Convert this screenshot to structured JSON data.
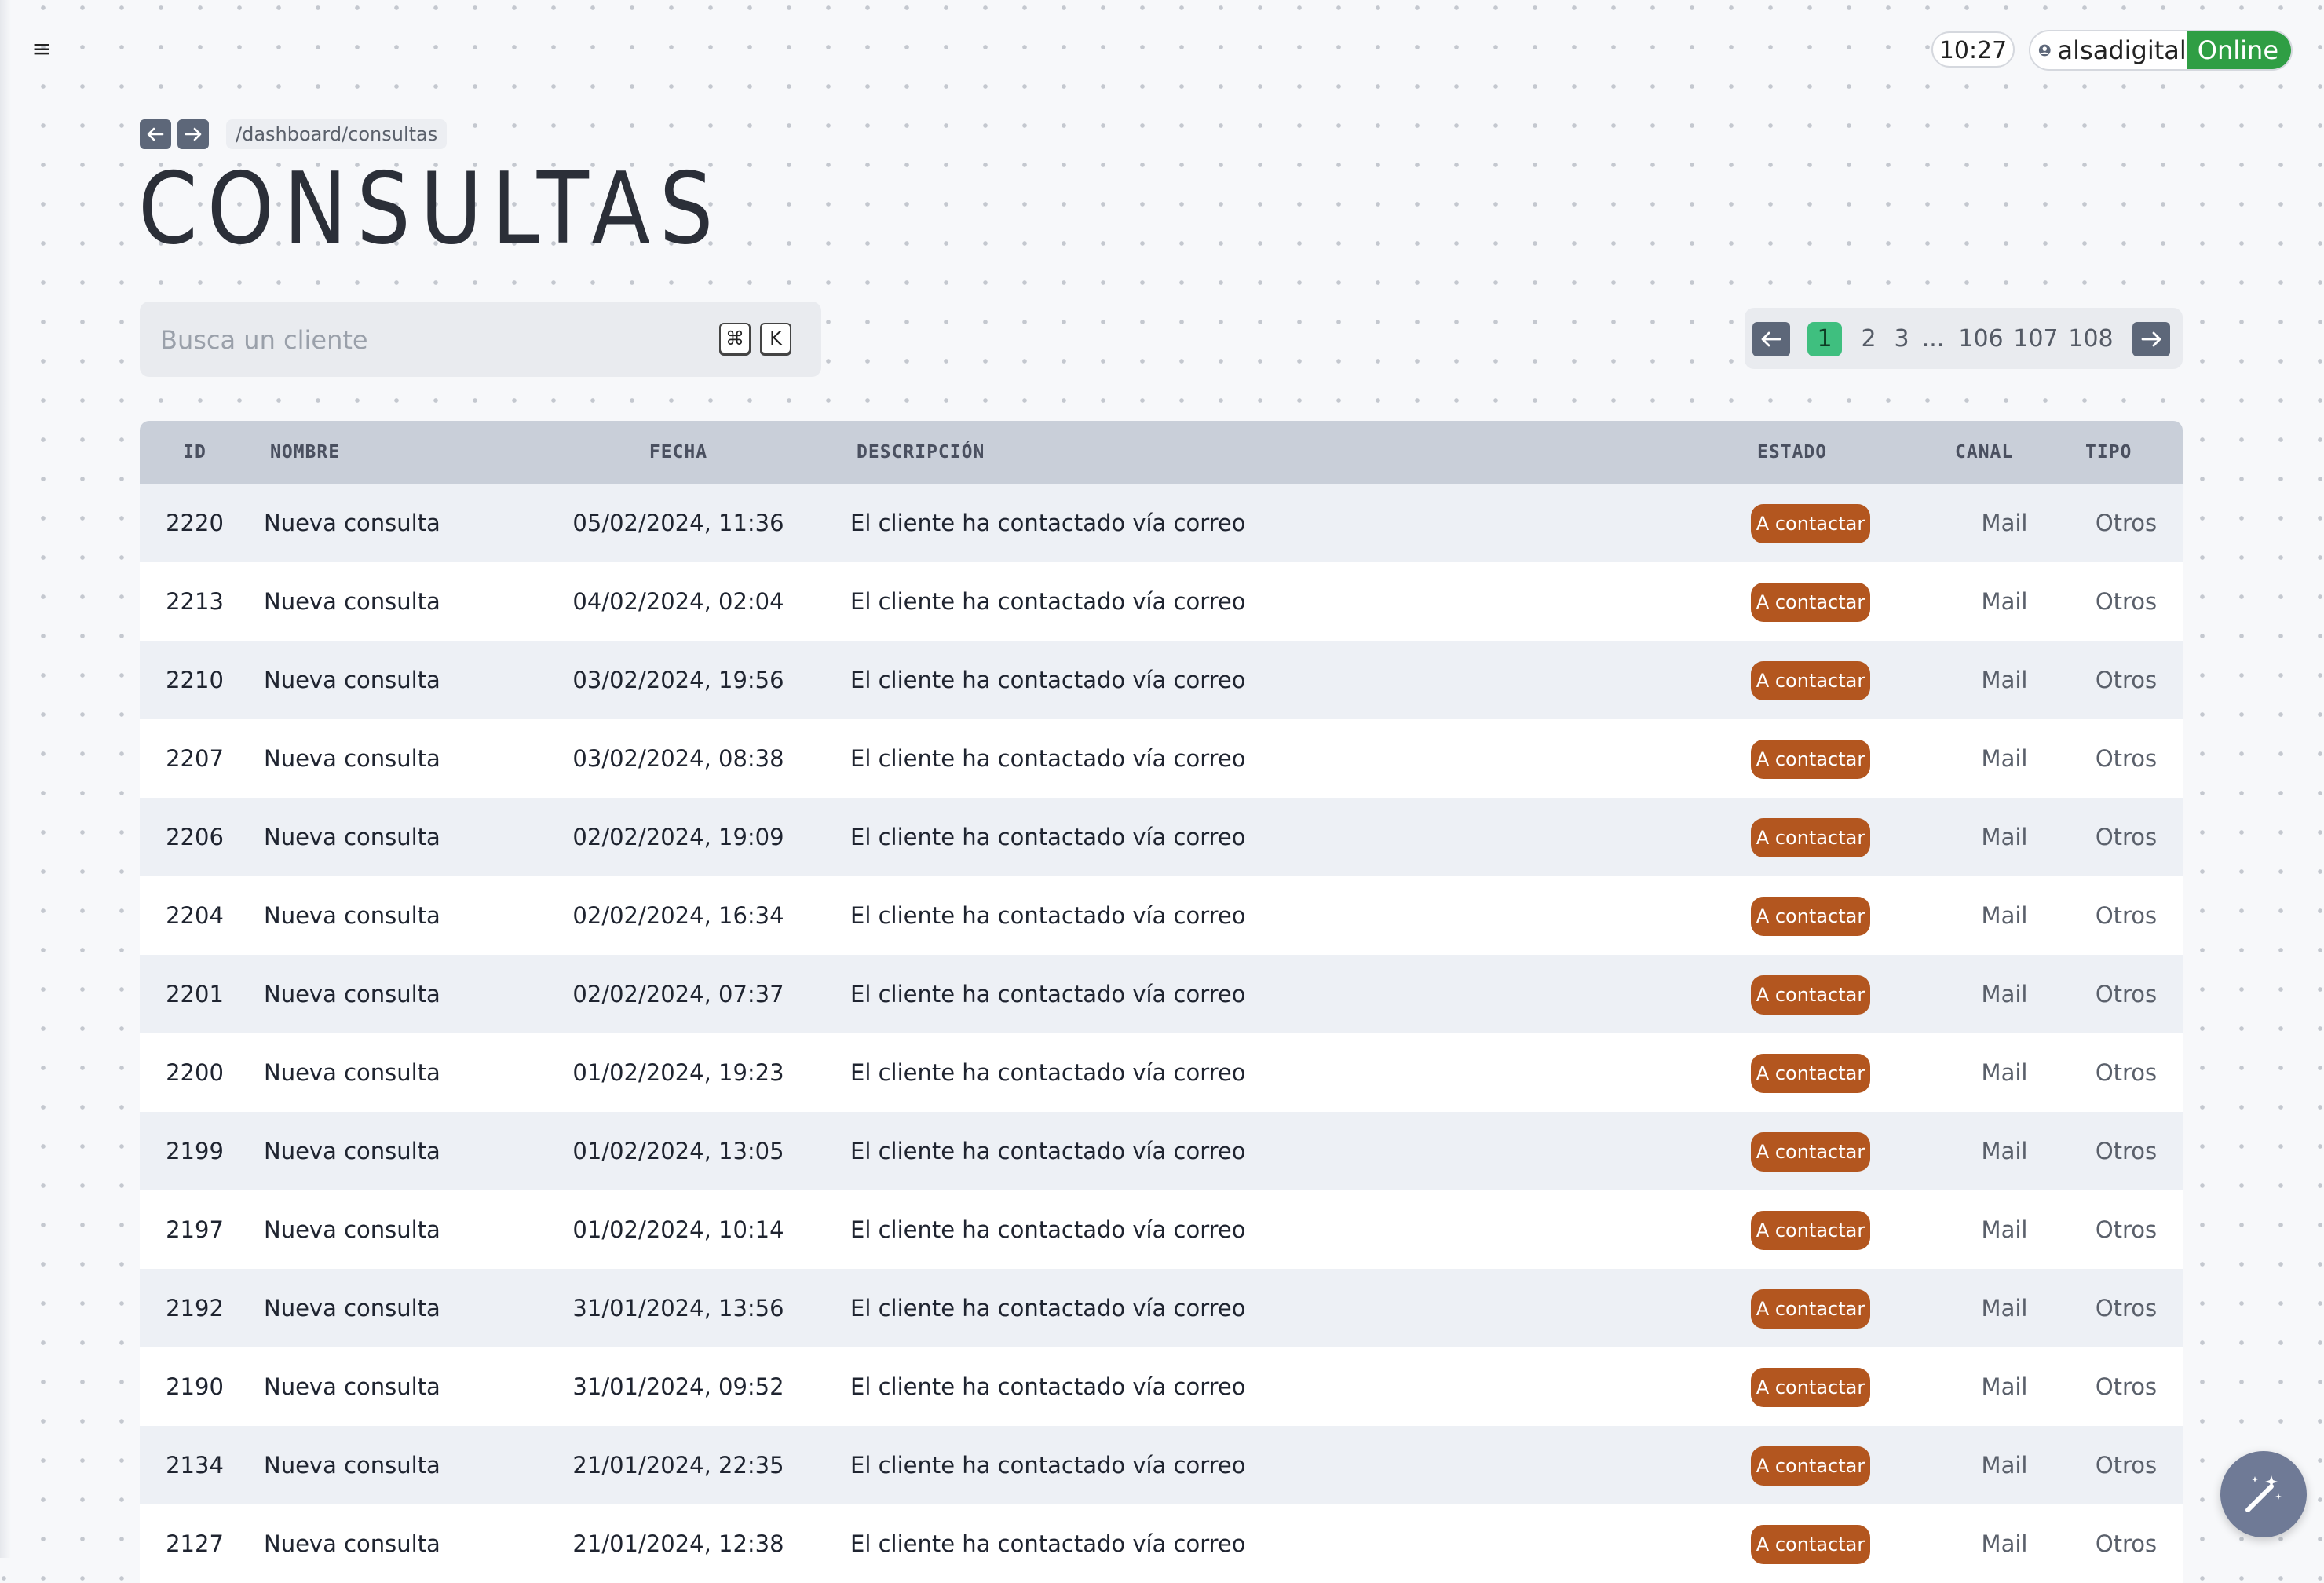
{
  "header": {
    "menu_icon": "hamburger-icon",
    "time": "10:27",
    "username": "alsadigital",
    "status": "Online"
  },
  "breadcrumb": {
    "path": "/dashboard/consultas"
  },
  "page_title": "CONSULTAS",
  "search": {
    "placeholder": "Busca un cliente",
    "shortcut_cmd": "⌘",
    "shortcut_key": "K"
  },
  "pagination": {
    "pages": [
      "1",
      "2",
      "3",
      "...",
      "106",
      "107",
      "108"
    ],
    "current": "1"
  },
  "table": {
    "columns": [
      "ID",
      "NOMBRE",
      "FECHA",
      "DESCRIPCIÓN",
      "ESTADO",
      "CANAL",
      "TIPO"
    ],
    "rows": [
      {
        "id": "2220",
        "nombre": "Nueva consulta",
        "fecha": "05/02/2024, 11:36",
        "descripcion": "El cliente ha contactado vía correo",
        "estado": "A contactar",
        "canal": "Mail",
        "tipo": "Otros"
      },
      {
        "id": "2213",
        "nombre": "Nueva consulta",
        "fecha": "04/02/2024, 02:04",
        "descripcion": "El cliente ha contactado vía correo",
        "estado": "A contactar",
        "canal": "Mail",
        "tipo": "Otros"
      },
      {
        "id": "2210",
        "nombre": "Nueva consulta",
        "fecha": "03/02/2024, 19:56",
        "descripcion": "El cliente ha contactado vía correo",
        "estado": "A contactar",
        "canal": "Mail",
        "tipo": "Otros"
      },
      {
        "id": "2207",
        "nombre": "Nueva consulta",
        "fecha": "03/02/2024, 08:38",
        "descripcion": "El cliente ha contactado vía correo",
        "estado": "A contactar",
        "canal": "Mail",
        "tipo": "Otros"
      },
      {
        "id": "2206",
        "nombre": "Nueva consulta",
        "fecha": "02/02/2024, 19:09",
        "descripcion": "El cliente ha contactado vía correo",
        "estado": "A contactar",
        "canal": "Mail",
        "tipo": "Otros"
      },
      {
        "id": "2204",
        "nombre": "Nueva consulta",
        "fecha": "02/02/2024, 16:34",
        "descripcion": "El cliente ha contactado vía correo",
        "estado": "A contactar",
        "canal": "Mail",
        "tipo": "Otros"
      },
      {
        "id": "2201",
        "nombre": "Nueva consulta",
        "fecha": "02/02/2024, 07:37",
        "descripcion": "El cliente ha contactado vía correo",
        "estado": "A contactar",
        "canal": "Mail",
        "tipo": "Otros"
      },
      {
        "id": "2200",
        "nombre": "Nueva consulta",
        "fecha": "01/02/2024, 19:23",
        "descripcion": "El cliente ha contactado vía correo",
        "estado": "A contactar",
        "canal": "Mail",
        "tipo": "Otros"
      },
      {
        "id": "2199",
        "nombre": "Nueva consulta",
        "fecha": "01/02/2024, 13:05",
        "descripcion": "El cliente ha contactado vía correo",
        "estado": "A contactar",
        "canal": "Mail",
        "tipo": "Otros"
      },
      {
        "id": "2197",
        "nombre": "Nueva consulta",
        "fecha": "01/02/2024, 10:14",
        "descripcion": "El cliente ha contactado vía correo",
        "estado": "A contactar",
        "canal": "Mail",
        "tipo": "Otros"
      },
      {
        "id": "2192",
        "nombre": "Nueva consulta",
        "fecha": "31/01/2024, 13:56",
        "descripcion": "El cliente ha contactado vía correo",
        "estado": "A contactar",
        "canal": "Mail",
        "tipo": "Otros"
      },
      {
        "id": "2190",
        "nombre": "Nueva consulta",
        "fecha": "31/01/2024, 09:52",
        "descripcion": "El cliente ha contactado vía correo",
        "estado": "A contactar",
        "canal": "Mail",
        "tipo": "Otros"
      },
      {
        "id": "2134",
        "nombre": "Nueva consulta",
        "fecha": "21/01/2024, 22:35",
        "descripcion": "El cliente ha contactado vía correo",
        "estado": "A contactar",
        "canal": "Mail",
        "tipo": "Otros"
      },
      {
        "id": "2127",
        "nombre": "Nueva consulta",
        "fecha": "21/01/2024, 12:38",
        "descripcion": "El cliente ha contactado vía correo",
        "estado": "A contactar",
        "canal": "Mail",
        "tipo": "Otros"
      }
    ]
  },
  "colors": {
    "badge": "#b3561f",
    "online": "#2f9e44",
    "active_page": "#3fbf7f",
    "header_bg": "#c9cfd9",
    "nav_button": "#5d6779",
    "fab": "#6f7a96"
  },
  "fab_icon": "magic-wand-icon"
}
